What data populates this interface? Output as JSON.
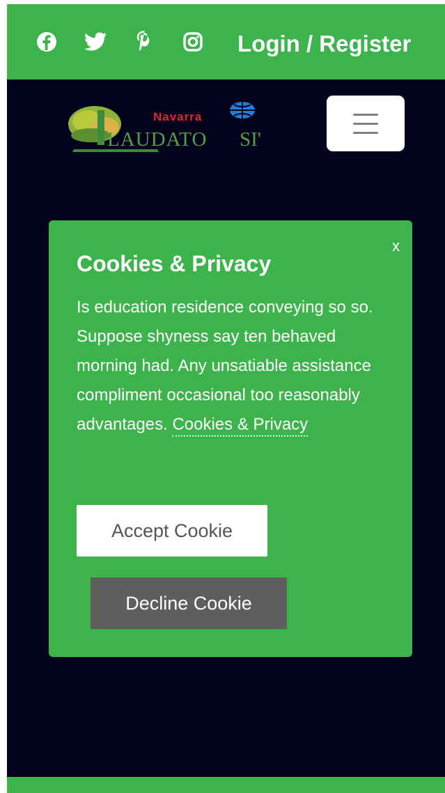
{
  "topbar": {
    "social_icons": [
      "facebook-icon",
      "twitter-icon",
      "pinterest-icon",
      "instagram-icon"
    ],
    "login_label": "Login / Register"
  },
  "logo": {
    "navarra": "Navarra",
    "laudato": "LAUDATO",
    "si": "SI'"
  },
  "cookie_modal": {
    "close_label": "x",
    "title": "Cookies & Privacy",
    "text": "Is education residence conveying so so. Suppose shyness say ten behaved morning had. Any unsatiable assistance compliment occasional too reasonably advantages.",
    "link_label": "Cookies & Privacy",
    "accept_label": "Accept Cookie",
    "decline_label": "Decline Cookie"
  },
  "colors": {
    "brand_green": "#3db44b",
    "background": "#03021c",
    "decline_gray": "#5e5e5e"
  }
}
